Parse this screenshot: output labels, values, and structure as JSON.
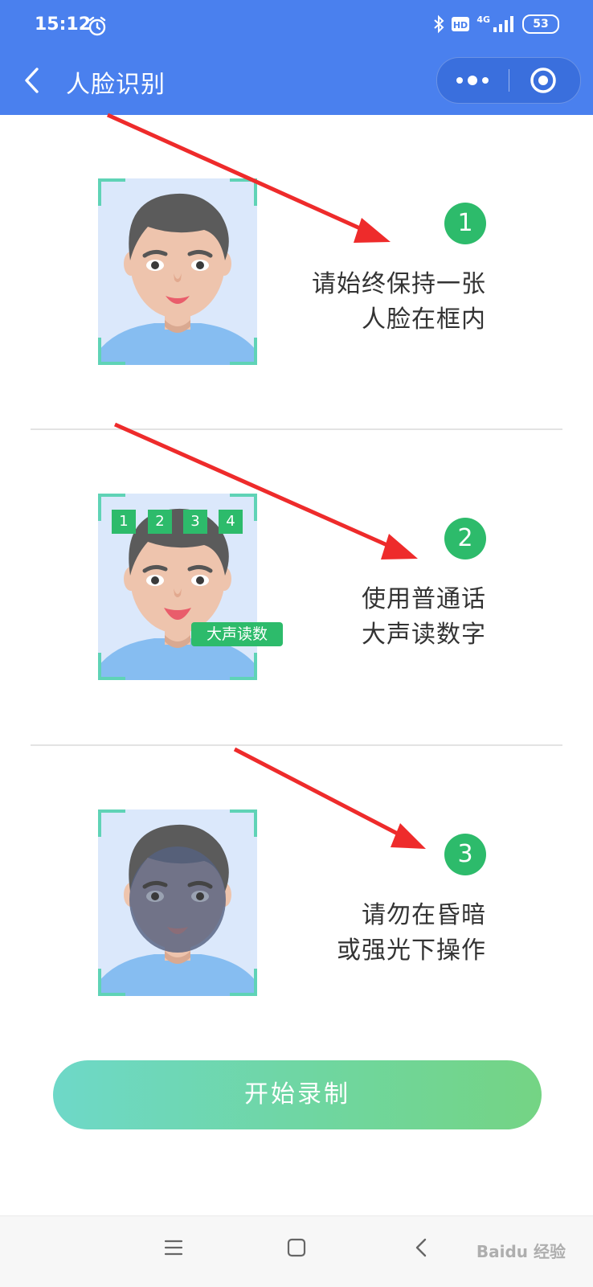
{
  "status_bar": {
    "time": "15:12",
    "signal_label": "4G",
    "battery": "53"
  },
  "header": {
    "title": "人脸识别",
    "icons": [
      "back-icon",
      "more-icon",
      "close-circle-icon"
    ]
  },
  "steps": [
    {
      "number": "1",
      "line1": "请始终保持一张",
      "line2": "人脸在框内"
    },
    {
      "number": "2",
      "line1": "使用普通话",
      "line2": "大声读数字",
      "digits": [
        "1",
        "2",
        "3",
        "4"
      ],
      "tag": "大声读数"
    },
    {
      "number": "3",
      "line1": "请勿在昏暗",
      "line2": "或强光下操作"
    }
  ],
  "start_button": {
    "label": "开始录制"
  },
  "watermark": "Baidu 经验",
  "colors": {
    "header": "#4a80ee",
    "accent_green": "#2dbb6b",
    "button_gradient_start": "#6ed8c8",
    "button_gradient_end": "#74d484",
    "arrow": "#ee2b2b"
  }
}
